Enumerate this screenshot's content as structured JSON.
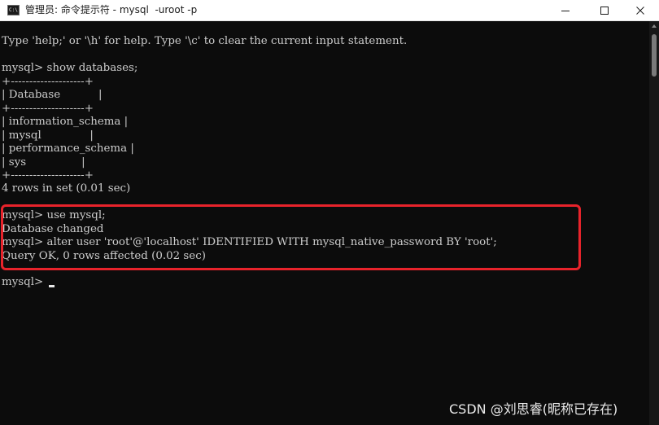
{
  "window": {
    "title": "管理员: 命令提示符 - mysql  -uroot -p",
    "icon": "terminal-icon",
    "controls": [
      "minimize-icon",
      "maximize-icon",
      "close-icon"
    ],
    "accent_color": "#e8232b"
  },
  "console": {
    "lines": [
      "Type 'help;' or '\\h' for help. Type '\\c' to clear the current input statement.",
      "",
      "mysql> show databases;",
      "+--------------------+",
      "| Database           |",
      "+--------------------+",
      "| information_schema |",
      "| mysql              |",
      "| performance_schema |",
      "| sys                |",
      "+--------------------+",
      "4 rows in set (0.01 sec)",
      "",
      "mysql> use mysql;",
      "Database changed",
      "mysql> alter user 'root'@'localhost' IDENTIFIED WITH mysql_native_password BY 'root';",
      "Query OK, 0 rows affected (0.02 sec)",
      "",
      "mysql> "
    ]
  },
  "watermark": "CSDN @刘思睿(昵称已存在)"
}
